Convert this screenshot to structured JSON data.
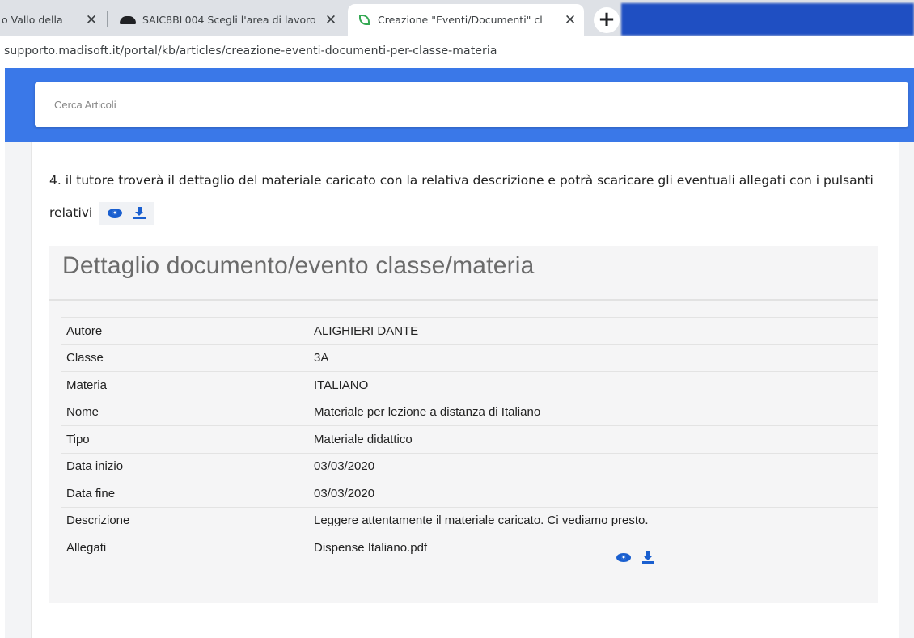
{
  "browser": {
    "tabs": [
      {
        "title": "o Vallo della",
        "icon": "page-icon",
        "active": false
      },
      {
        "title": "SAIC8BL004 Scegli l'area di lavoro",
        "icon": "cloud-icon",
        "active": false
      },
      {
        "title": "Creazione \"Eventi/Documenti\" cl",
        "icon": "leaf-icon",
        "active": true
      }
    ],
    "new_tab_symbol": "+",
    "close_symbol": "✕",
    "url": "supporto.madisoft.it/portal/kb/articles/creazione-eventi-documenti-per-classe-materia"
  },
  "page": {
    "accent_color": "#3a78e8",
    "search_placeholder": "Cerca Articoli",
    "step_text": "4. il tutore troverà il dettaglio del materiale caricato con la relativa descrizione e potrà scaricare gli eventuali allegati con i pulsanti relativi",
    "detail": {
      "title": "Dettaglio documento/evento classe/materia",
      "rows": [
        {
          "label": "Autore",
          "value": "ALIGHIERI DANTE"
        },
        {
          "label": "Classe",
          "value": "3A"
        },
        {
          "label": "Materia",
          "value": "ITALIANO"
        },
        {
          "label": "Nome",
          "value": "Materiale per lezione a distanza di Italiano"
        },
        {
          "label": "Tipo",
          "value": "Materiale didattico"
        },
        {
          "label": "Data inizio",
          "value": "03/03/2020"
        },
        {
          "label": "Data fine",
          "value": "03/03/2020"
        },
        {
          "label": "Descrizione",
          "value": "Leggere attentamente il materiale caricato. Ci vediamo presto."
        },
        {
          "label": "Allegati",
          "value": "Dispense Italiano.pdf"
        }
      ]
    },
    "icon_color": "#1a5fcf"
  }
}
